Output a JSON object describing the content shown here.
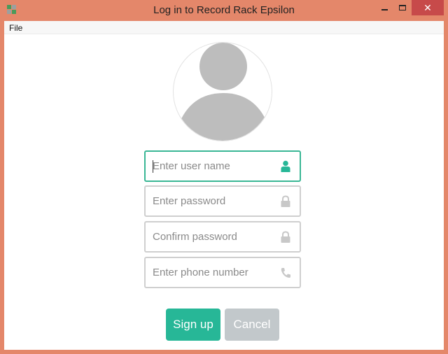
{
  "window": {
    "title": "Log in to Record Rack Epsilon",
    "close_label": "✕",
    "app_icon": "app-logo-icon"
  },
  "menu": {
    "file_label": "File"
  },
  "form": {
    "username_placeholder": "Enter user name",
    "password_placeholder": "Enter password",
    "confirm_placeholder": "Confirm password",
    "phone_placeholder": "Enter phone number",
    "icons": [
      "user-icon",
      "lock-icon",
      "lock-icon",
      "phone-icon"
    ]
  },
  "buttons": {
    "signup_label": "Sign up",
    "cancel_label": "Cancel"
  },
  "colors": {
    "accent": "#27b797",
    "focus_border": "#3ab795",
    "frame": "#e4876a",
    "close": "#c74a4a",
    "cancel": "#c2c8cb",
    "avatar": "#bdbdbd"
  }
}
